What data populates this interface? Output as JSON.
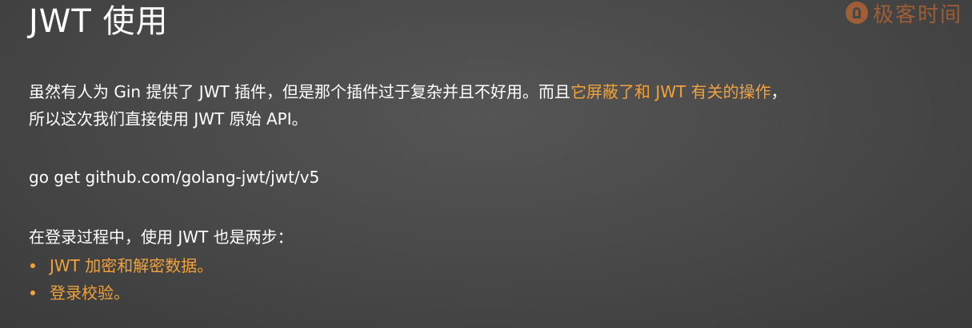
{
  "slide": {
    "title": "JWT 使用",
    "logo_text": "极客时间",
    "paragraph": {
      "part1": "虽然有人为 Gin 提供了 JWT 插件，但是那个插件过于复杂并且不好用。而且",
      "highlight": "它屏蔽了和 JWT 有关的操作",
      "part2": "，",
      "line2": "所以这次我们直接使用 JWT 原始 API。"
    },
    "command": "go get github.com/golang-jwt/jwt/v5",
    "intro": "在登录过程中，使用 JWT 也是两步：",
    "bullets": [
      "JWT 加密和解密数据。",
      "登录校验。"
    ]
  },
  "colors": {
    "background": "#4a4a4a",
    "text": "#ffffff",
    "accent": "#f0a23c"
  }
}
